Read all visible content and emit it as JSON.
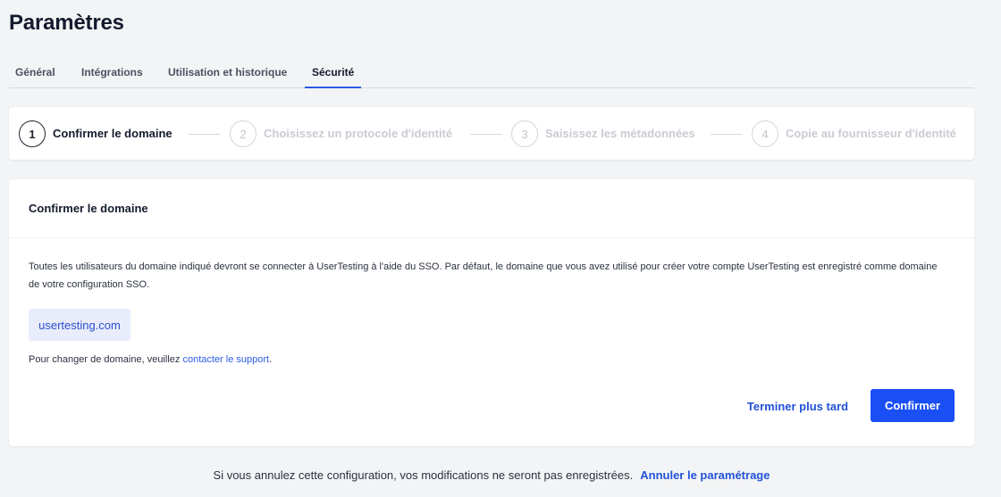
{
  "page": {
    "title": "Paramètres"
  },
  "tabs": [
    {
      "label": "Général"
    },
    {
      "label": "Intégrations"
    },
    {
      "label": "Utilisation et historique"
    },
    {
      "label": "Sécurité"
    }
  ],
  "stepper": {
    "steps": [
      {
        "number": "1",
        "label": "Confirmer le domaine"
      },
      {
        "number": "2",
        "label": "Choisissez un protocole d'identité"
      },
      {
        "number": "3",
        "label": "Saisissez les métadonnées"
      },
      {
        "number": "4",
        "label": "Copie au fournisseur d'identité"
      }
    ]
  },
  "card": {
    "title": "Confirmer le domaine",
    "description": "Toutes les utilisateurs du domaine indiqué devront se connecter à UserTesting à l'aide du SSO. Par défaut, le domaine que vous avez utilisé pour créer votre compte UserTesting est enregistré comme domaine de votre configuration SSO.",
    "domain": "usertesting.com",
    "support_prefix": "Pour changer de domaine, veuillez ",
    "support_link": "contacter le support",
    "support_suffix": ".",
    "later_button": "Terminer plus tard",
    "confirm_button": "Confirmer"
  },
  "footer": {
    "text": "Si vous annulez cette configuration, vos modifications ne seront pas enregistrées.",
    "link": "Annuler le paramétrage"
  },
  "colors": {
    "accent": "#1a4ff5",
    "link": "#2152d9",
    "chip_bg": "#e8ecfb"
  }
}
